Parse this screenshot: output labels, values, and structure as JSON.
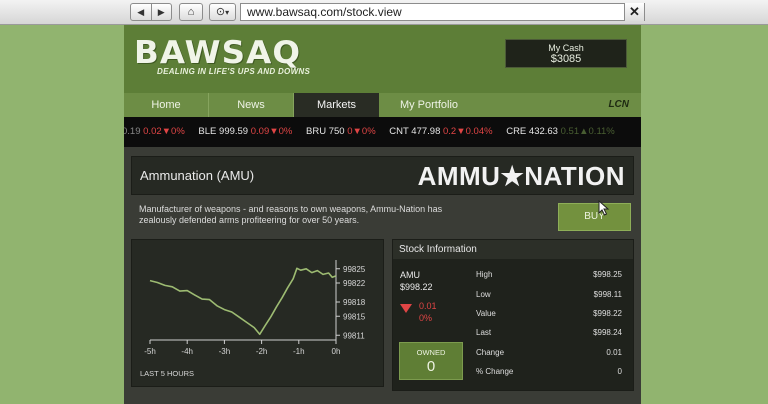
{
  "browser": {
    "back_icon": "◀",
    "forward_icon": "▶",
    "home_icon": "⌂",
    "history_icon": "⊙",
    "history_caret": "▾",
    "url": "www.bawsaq.com/stock.view",
    "close_icon": "✕"
  },
  "site": {
    "logo": "BAWSAQ",
    "tagline": "DEALING IN LIFE'S UPS AND DOWNS",
    "cash_label": "My Cash",
    "cash_value": "$3085",
    "nav": [
      "Home",
      "News",
      "Markets",
      "My Portfolio"
    ],
    "active_tab": "Markets",
    "nav_logo": "LCN"
  },
  "ticker": [
    {
      "sym": "0.19",
      "price": "",
      "change": "0.02",
      "pct": "0%",
      "dir": "down"
    },
    {
      "sym": "BLE",
      "price": "999.59",
      "change": "0.09",
      "pct": "0%",
      "dir": "down"
    },
    {
      "sym": "BRU",
      "price": "750",
      "change": "0",
      "pct": "0%",
      "dir": "down"
    },
    {
      "sym": "CNT",
      "price": "477.98",
      "change": "0.2",
      "pct": "0.04%",
      "dir": "down"
    },
    {
      "sym": "CRE",
      "price": "432.63",
      "change": "0.51",
      "pct": "0.11%",
      "dir": "up"
    }
  ],
  "stock": {
    "name": "Ammunation (AMU)",
    "brand": "AMMU★NATION",
    "description": "Manufacturer of weapons - and reasons to own weapons, Ammu-Nation has zealously defended arms profiteering for over 50 years.",
    "buy_label": "BUY"
  },
  "info": {
    "heading": "Stock Information",
    "symbol": "AMU",
    "price": "$998.22",
    "change": "0.01",
    "change_pct": "0%",
    "owned_label": "OWNED",
    "owned_value": "0",
    "rows": [
      {
        "label": "High",
        "value": "$998.25"
      },
      {
        "label": "Low",
        "value": "$998.11"
      },
      {
        "label": "Value",
        "value": "$998.22"
      },
      {
        "label": "Last",
        "value": "$998.24"
      },
      {
        "label": "Change",
        "value": "0.01"
      },
      {
        "label": "% Change",
        "value": "0"
      }
    ]
  },
  "colors": {
    "brand_green": "#5d7e37",
    "down": "#e04545",
    "up": "#7aa050",
    "line": "#9dbb72"
  },
  "chart_data": {
    "type": "line",
    "title": "",
    "xlabel": "LAST 5 HOURS",
    "ylabel": "",
    "x_ticks": [
      "-5h",
      "-4h",
      "-3h",
      "-2h",
      "-1h",
      "0h"
    ],
    "y_ticks": [
      "99825",
      "99822",
      "99818",
      "99815",
      "99811"
    ],
    "ylim": [
      99810,
      99826
    ],
    "xlim": [
      -5,
      0
    ],
    "series": [
      {
        "x": [
          -5,
          -4.8,
          -4.6,
          -4.4,
          -4.2,
          -4.0,
          -3.8,
          -3.6,
          -3.4,
          -3.2,
          -3.0,
          -2.8,
          -2.6,
          -2.4,
          -2.2,
          -2.05,
          -1.9,
          -1.75,
          -1.6,
          -1.45,
          -1.3,
          -1.15,
          -1.05,
          -0.95,
          -0.8,
          -0.65,
          -0.5,
          -0.35,
          -0.2,
          -0.1,
          0
        ],
        "y": [
          99822.5,
          99822.1,
          99821.5,
          99821.2,
          99820.3,
          99820.4,
          99819.5,
          99818.6,
          99818.5,
          99817.2,
          99816.4,
          99815.9,
          99814.8,
          99813.7,
          99812.6,
          99811.2,
          99813.1,
          99814.9,
          99817.0,
          99818.9,
          99821.0,
          99822.9,
          99825.1,
          99824.7,
          99825.0,
          99824.2,
          99824.6,
          99823.8,
          99824.1,
          99823.2,
          99823.5
        ]
      }
    ]
  }
}
